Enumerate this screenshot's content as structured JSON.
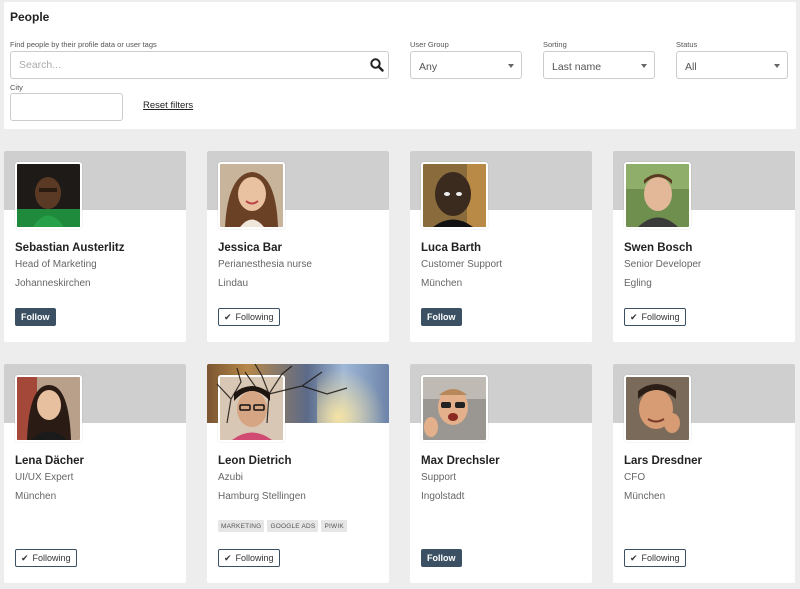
{
  "page": {
    "title": "People"
  },
  "filters": {
    "search_label": "Find people by their profile data or user tags",
    "search_placeholder": "Search...",
    "user_group_label": "User Group",
    "user_group_value": "Any",
    "sorting_label": "Sorting",
    "sorting_value": "Last name",
    "status_label": "Status",
    "status_value": "All",
    "city_label": "City",
    "city_value": "",
    "reset_label": "Reset filters"
  },
  "colors": {
    "accent": "#3b5163",
    "banner": "#cfcfcf",
    "background": "#ededed"
  },
  "people": [
    {
      "name": "Sebastian Austerlitz",
      "role": "Head of Marketing",
      "location": "Johanneskirchen",
      "button": "Follow",
      "following": false,
      "tags": []
    },
    {
      "name": "Jessica Bar",
      "role": "Perianesthesia nurse",
      "location": "Lindau",
      "button": "Following",
      "following": true,
      "tags": []
    },
    {
      "name": "Luca Barth",
      "role": "Customer Support",
      "location": "München",
      "button": "Follow",
      "following": false,
      "tags": []
    },
    {
      "name": "Swen Bosch",
      "role": "Senior Developer",
      "location": "Egling",
      "button": "Following",
      "following": true,
      "tags": []
    },
    {
      "name": "Lena Dächer",
      "role": "UI/UX Expert",
      "location": "München",
      "button": "Following",
      "following": true,
      "tags": []
    },
    {
      "name": "Leon Dietrich",
      "role": "Azubi",
      "location": "Hamburg Stellingen",
      "button": "Following",
      "following": true,
      "tags": [
        "MARKETING",
        "GOOGLE ADS",
        "PIWIK"
      ]
    },
    {
      "name": "Max Drechsler",
      "role": "Support",
      "location": "Ingolstadt",
      "button": "Follow",
      "following": false,
      "tags": []
    },
    {
      "name": "Lars Dresdner",
      "role": "CFO",
      "location": "München",
      "button": "Following",
      "following": true,
      "tags": []
    }
  ]
}
